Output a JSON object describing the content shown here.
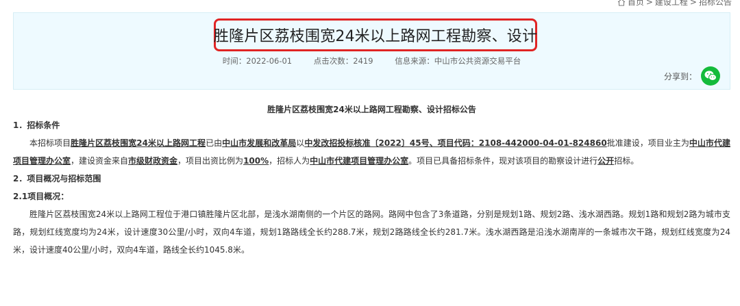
{
  "breadcrumb": {
    "home": "首页",
    "sep1": ">",
    "section": "建设工程",
    "sep2": ">",
    "current": "招标公告"
  },
  "header": {
    "title": "胜隆片区荔枝围宽24米以上路网工程勘察、设计",
    "time_label": "时间：",
    "time": "2022-06-01",
    "clicks_label": "点击次数：",
    "clicks": "2419",
    "source_label": "信息来源：",
    "source": "中山市公共资源交易平台",
    "share_label": "分享到：",
    "highlight_color": "#e02424",
    "share_icon": "wechat-icon",
    "share_icon_color": "#14bb3b"
  },
  "content": {
    "notice_title": "胜隆片区荔枝围宽24米以上路网工程勘察、设计招标公告",
    "section1": "1．招标条件",
    "p1": {
      "t1": "本招标项目",
      "project": "胜隆片区荔枝围宽24米以上路网工程",
      "t2": "已由",
      "approver": "中山市发展和改革局",
      "t3": "以",
      "approval_no": "中发改招投标核准〔2022〕45号、项目代码：2108-442000-04-01-824860",
      "t4": "批准建设，项目业主为",
      "owner": "中山市代建项目管理办公室",
      "t5": "，建设资金来自",
      "fund": "市级财政资金",
      "t6": "，项目出资比例为",
      "ratio": "100%",
      "t7": "，招标人为",
      "tenderer": "中山市代建项目管理办公室",
      "t8": "。项目已具备招标条件，现对该项目的勘察设计进行",
      "mode": "公开",
      "t9": "招标。"
    },
    "section2": "2．项目概况与招标范围",
    "section21": "2.1项目概况：",
    "p2": "胜隆片区荔枝围宽24米以上路网工程位于港口镇胜隆片区北部，是浅水湖南侧的一个片区的路网。路网中包含了3条道路，分别是规划1路、规划2路、浅水湖西路。规划1路和规划2路为城市支路，规划红线宽度均为24米，设计速度30公里/小时，双向4车道，规划1路路线全长约288.7米，规划2路路线全长约281.7米。浅水湖西路是沿浅水湖南岸的一条城市次干路，规划红线宽度为24米，设计速度40公里/小时，双向4车道，路线全长约1045.8米。"
  }
}
